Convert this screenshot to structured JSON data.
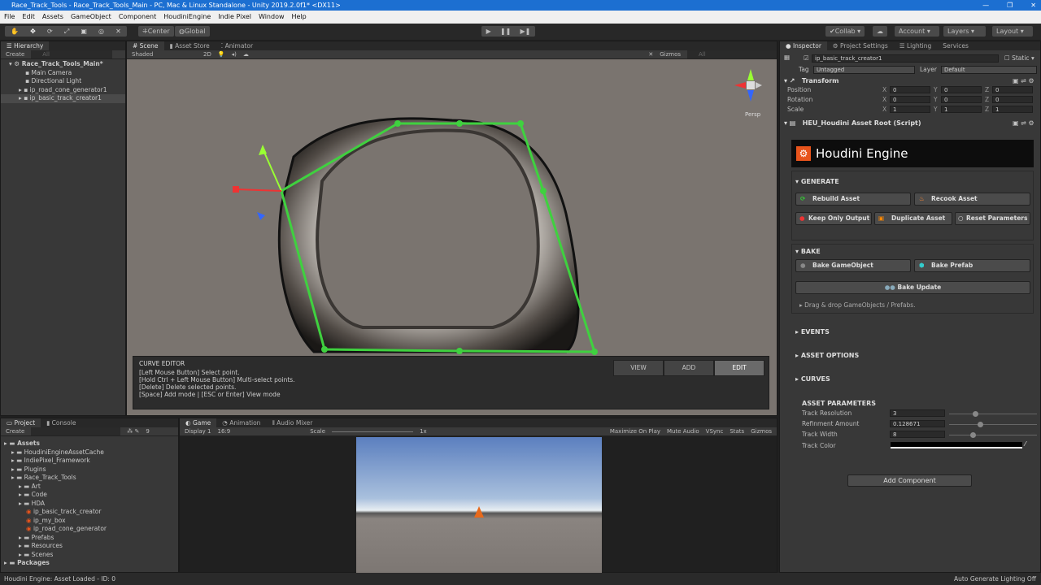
{
  "window": {
    "title": "Race_Track_Tools - Race_Track_Tools_Main - PC, Mac & Linux Standalone - Unity 2019.2.0f1* <DX11>"
  },
  "menu": [
    "File",
    "Edit",
    "Assets",
    "GameObject",
    "Component",
    "HoudiniEngine",
    "Indie Pixel",
    "Window",
    "Help"
  ],
  "toolbar": {
    "center": "Center",
    "global": "Global",
    "collab": "Collab",
    "account": "Account",
    "layers": "Layers",
    "layout": "Layout"
  },
  "hierarchy": {
    "tab": "Hierarchy",
    "create": "Create",
    "search_placeholder": "All",
    "scene": "Race_Track_Tools_Main*",
    "items": [
      "Main Camera",
      "Directional Light",
      "ip_road_cone_generator1",
      "ip_basic_track_creator1"
    ]
  },
  "scene": {
    "tabs": [
      "Scene",
      "Asset Store",
      "Animator"
    ],
    "shading": "Shaded",
    "mode2d": "2D",
    "gizmos": "Gizmos",
    "search_placeholder": "All",
    "persp": "Persp",
    "curve_editor": {
      "title": "CURVE EDITOR",
      "lines": [
        "[Left Mouse Button] Select point.",
        "[Hold Ctrl + Left Mouse Button] Multi-select points.",
        "[Delete] Delete selected points.",
        "[Space] Add mode | [ESC or Enter] View mode"
      ],
      "modes": [
        "VIEW",
        "ADD",
        "EDIT"
      ],
      "active_mode": "EDIT"
    }
  },
  "inspector": {
    "tabs": [
      "Inspector",
      "Project Settings",
      "Lighting",
      "Services"
    ],
    "object_name": "ip_basic_track_creator1",
    "static": "Static",
    "tag_label": "Tag",
    "tag": "Untagged",
    "layer_label": "Layer",
    "layer": "Default",
    "transform": {
      "title": "Transform",
      "rows": [
        {
          "label": "Position",
          "x": "0",
          "y": "0",
          "z": "0"
        },
        {
          "label": "Rotation",
          "x": "0",
          "y": "0",
          "z": "0"
        },
        {
          "label": "Scale",
          "x": "1",
          "y": "1",
          "z": "1"
        }
      ]
    },
    "script_title": "HEU_Houdini Asset Root (Script)",
    "banner": "Houdini Engine",
    "generate": "GENERATE",
    "rebuild": "Rebuild Asset",
    "recook": "Recook Asset",
    "keep_only": "Keep Only Output",
    "duplicate": "Duplicate Asset",
    "reset": "Reset Parameters",
    "bake": "BAKE",
    "bake_go": "Bake GameObject",
    "bake_prefab": "Bake Prefab",
    "bake_update": "Bake Update",
    "drag_drop": "Drag & drop GameObjects / Prefabs.",
    "events": "EVENTS",
    "asset_options": "ASSET OPTIONS",
    "curves": "CURVES",
    "asset_params": "ASSET PARAMETERS",
    "params": [
      {
        "label": "Track Resolution",
        "value": "3",
        "slider": 0.3
      },
      {
        "label": "Refinment Amount",
        "value": "0.128671",
        "slider": 0.35
      },
      {
        "label": "Track Width",
        "value": "8",
        "slider": 0.27
      }
    ],
    "track_color_label": "Track Color",
    "track_color": "#000000",
    "add_component": "Add Component"
  },
  "project": {
    "tabs": [
      "Project",
      "Console"
    ],
    "create": "Create",
    "count": "9",
    "tree": [
      {
        "label": "Assets",
        "depth": 0,
        "bold": true
      },
      {
        "label": "HoudiniEngineAssetCache",
        "depth": 1
      },
      {
        "label": "IndiePixel_Framework",
        "depth": 1
      },
      {
        "label": "Plugins",
        "depth": 1
      },
      {
        "label": "Race_Track_Tools",
        "depth": 1
      },
      {
        "label": "Art",
        "depth": 2
      },
      {
        "label": "Code",
        "depth": 2
      },
      {
        "label": "HDA",
        "depth": 2
      },
      {
        "label": "ip_basic_track_creator",
        "depth": 3,
        "hda": true
      },
      {
        "label": "ip_my_box",
        "depth": 3,
        "hda": true
      },
      {
        "label": "ip_road_cone_generator",
        "depth": 3,
        "hda": true
      },
      {
        "label": "Prefabs",
        "depth": 2
      },
      {
        "label": "Resources",
        "depth": 2
      },
      {
        "label": "Scenes",
        "depth": 2
      },
      {
        "label": "Packages",
        "depth": 0,
        "bold": true
      }
    ]
  },
  "game": {
    "tabs": [
      "Game",
      "Animation",
      "Audio Mixer"
    ],
    "display": "Display 1",
    "aspect": "16:9",
    "scale_label": "Scale",
    "scale": "1x",
    "options": [
      "Maximize On Play",
      "Mute Audio",
      "VSync",
      "Stats",
      "Gizmos"
    ]
  },
  "status": {
    "left": "Houdini Engine: Asset Loaded - ID: 0",
    "right": "Auto Generate Lighting Off"
  },
  "colors": {
    "curve": "#3fd13f",
    "accent": "#1c6fd1",
    "scene_bg": "#7a746f"
  }
}
